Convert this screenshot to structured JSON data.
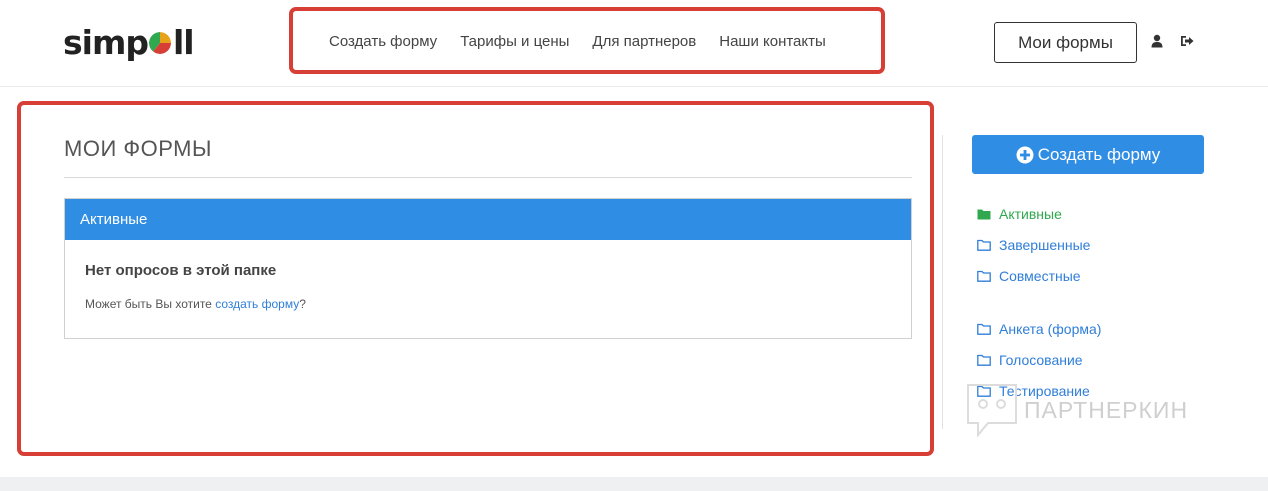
{
  "header": {
    "logo": {
      "part1": "simp",
      "part2": "ll",
      "dot_colors": [
        "#2fa84f",
        "#e8a21a",
        "#d63e36"
      ]
    },
    "nav": [
      "Создать форму",
      "Тарифы и цены",
      "Для партнеров",
      "Наши контакты"
    ],
    "my_forms_button": "Мои формы",
    "icons": [
      "user-icon",
      "sign-out-icon"
    ]
  },
  "main": {
    "title": "МОИ ФОРМЫ",
    "panel": {
      "heading": "Активные",
      "empty_title": "Нет опросов в этой папке",
      "hint_prefix": "Может быть Вы хотите ",
      "hint_link": "создать форму",
      "hint_suffix": "?"
    }
  },
  "sidebar": {
    "create_button": "Создать форму",
    "create_icon": "plus-circle-icon",
    "folders": [
      {
        "label": "Активные",
        "active": true
      },
      {
        "label": "Завершенные",
        "active": false
      },
      {
        "label": "Совместные",
        "active": false
      }
    ],
    "types": [
      {
        "label": "Анкета (форма)"
      },
      {
        "label": "Голосование"
      },
      {
        "label": "Тестирование"
      }
    ]
  },
  "watermark": "ПАРТНЕРКИН",
  "colors": {
    "accent": "#2f8de4",
    "link": "#2f7ed8",
    "active_folder": "#2fa84f",
    "highlight": "#d63e36"
  }
}
